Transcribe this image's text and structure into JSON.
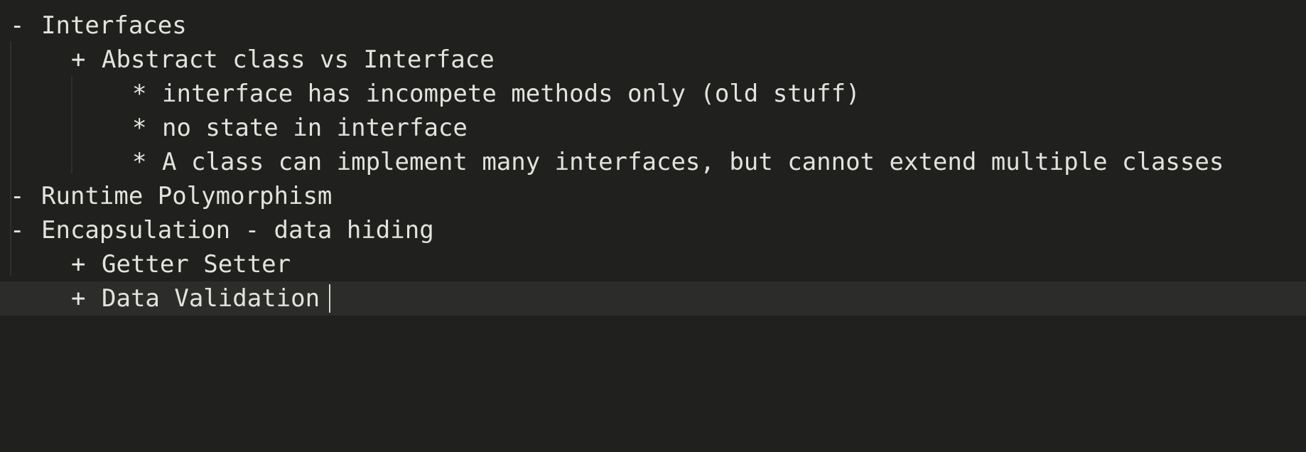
{
  "editor": {
    "theme": {
      "background": "#20211f",
      "current_line": "#2c2d2a",
      "text": "#e3e3dd"
    },
    "lines": [
      {
        "marker": "",
        "text": ""
      },
      {
        "marker": "-",
        "text": "Interfaces"
      },
      {
        "marker": "+",
        "text": "Abstract class vs Interface"
      },
      {
        "marker": "*",
        "text": "interface has incompete methods only (old stuff)"
      },
      {
        "marker": "*",
        "text": "no state in interface"
      },
      {
        "marker": "*",
        "text": "A class can implement many interfaces, but cannot extend multiple classes"
      },
      {
        "marker": "-",
        "text": "Runtime Polymorphism"
      },
      {
        "marker": "-",
        "text": "Encapsulation - data hiding"
      },
      {
        "marker": "+",
        "text": "Getter Setter"
      },
      {
        "marker": "+",
        "text": "Data Validation"
      }
    ]
  }
}
